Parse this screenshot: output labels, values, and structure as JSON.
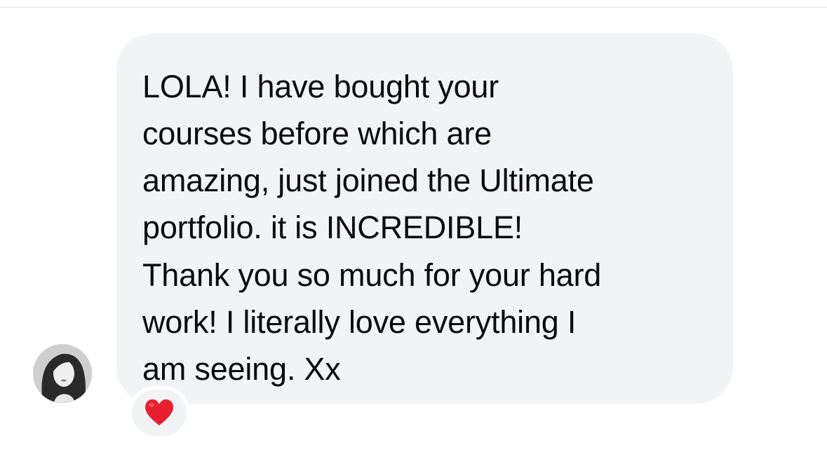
{
  "message": {
    "lines_paragraph_1": [
      "LOLA! I have bought your",
      "courses before which are",
      "amazing, just joined the Ultimate",
      "portfolio. it is INCREDIBLE!"
    ],
    "lines_paragraph_2": [
      "Thank you so much for your hard",
      "work! I literally love everything I",
      "am seeing. Xx"
    ]
  },
  "reaction": {
    "icon": "heart-icon",
    "color": "#e8202e"
  },
  "colors": {
    "bubble_background": "#f2f3f5",
    "text": "#0b0b0b",
    "heart": "#e8202e"
  }
}
